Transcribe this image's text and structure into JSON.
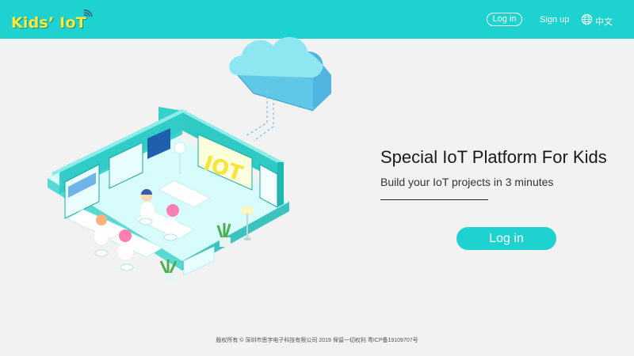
{
  "header": {
    "logo_text": "Kids’ IoT",
    "login_label": "Log in",
    "signup_label": "Sign up",
    "language_label": "中文",
    "background_color": "#1ed2cf",
    "logo_color": "#ffe83a"
  },
  "hero": {
    "title": "Special IoT Platform For Kids",
    "subtitle": "Build your IoT projects in 3 minutes",
    "login_button_label": "Log in"
  },
  "illustration": {
    "wall_sign_text": "IOT",
    "icons": [
      "cloud-icon",
      "wifi-icon",
      "globe-icon"
    ]
  },
  "footer": {
    "copyright": "版权所有 © 深圳市思字电子科技有限公司 2019 保留一切权利 粤ICP备19109707号"
  }
}
